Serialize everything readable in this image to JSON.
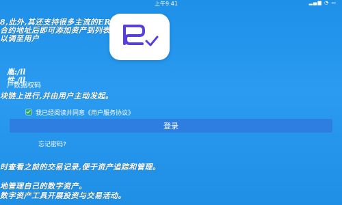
{
  "status_bar": {
    "time": "上午9:41",
    "icons": "▂▄▆ ◔ ▭"
  },
  "background_lines": [
    "8,此外,其还支持很多主流的ERC-20代币,用户",
    "合约地址后即可添加资产到列表中。",
    "以调至用户"
  ],
  "login_form": {
    "field_1_text": "胤:/ll",
    "field_2_text": "性,/ll",
    "password_placeholder": "户数据权码",
    "bg_line_mid": "块链上进行,并由用户主动发起。",
    "agree_checked": true,
    "agree_text": "我已经阅读并同意",
    "agree_link": "《用户服务协议》",
    "login_button": "登录",
    "forgot_password": "忘记密码?"
  },
  "background_lines_lower": [
    "时查看之前的交易记录,便于资产追踪和管理。",
    "地管理自己的数字资产。",
    "数字资产工具开展投资与交易活动。"
  ],
  "colors": {
    "background": "#1e90e8",
    "button": "#2e7de0",
    "checkbox": "#2ea862",
    "logo_glyph": "#5a3fd6"
  },
  "icons": {
    "logo": "imtoken-style-logo-icon"
  }
}
